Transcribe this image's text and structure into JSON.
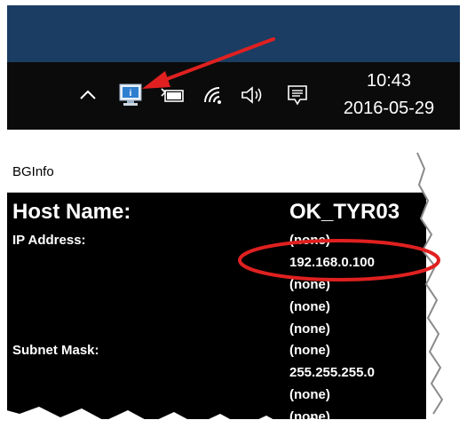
{
  "taskbar": {
    "clock_time": "10:43",
    "clock_date": "2016-05-29",
    "icons": [
      "chevron-up-icon",
      "bginfo-monitor-icon",
      "battery-icon",
      "wifi-icon",
      "volume-icon",
      "notification-icon"
    ]
  },
  "bginfo": {
    "window_title": "BGInfo",
    "host_name_label": "Host Name:",
    "host_name_value": "OK_TYR03",
    "ip_address_label": "IP Address:",
    "ip_values": [
      "(none)",
      "192.168.0.100",
      "(none)",
      "(none)",
      "(none)"
    ],
    "subnet_mask_label": "Subnet Mask:",
    "subnet_values": [
      "(none)",
      "255.255.255.0",
      "(none)",
      "(none)"
    ]
  },
  "colors": {
    "annotation_red": "#e02020",
    "taskbar_black": "#0b0b0b",
    "desktop_blue": "#1b3d63"
  }
}
